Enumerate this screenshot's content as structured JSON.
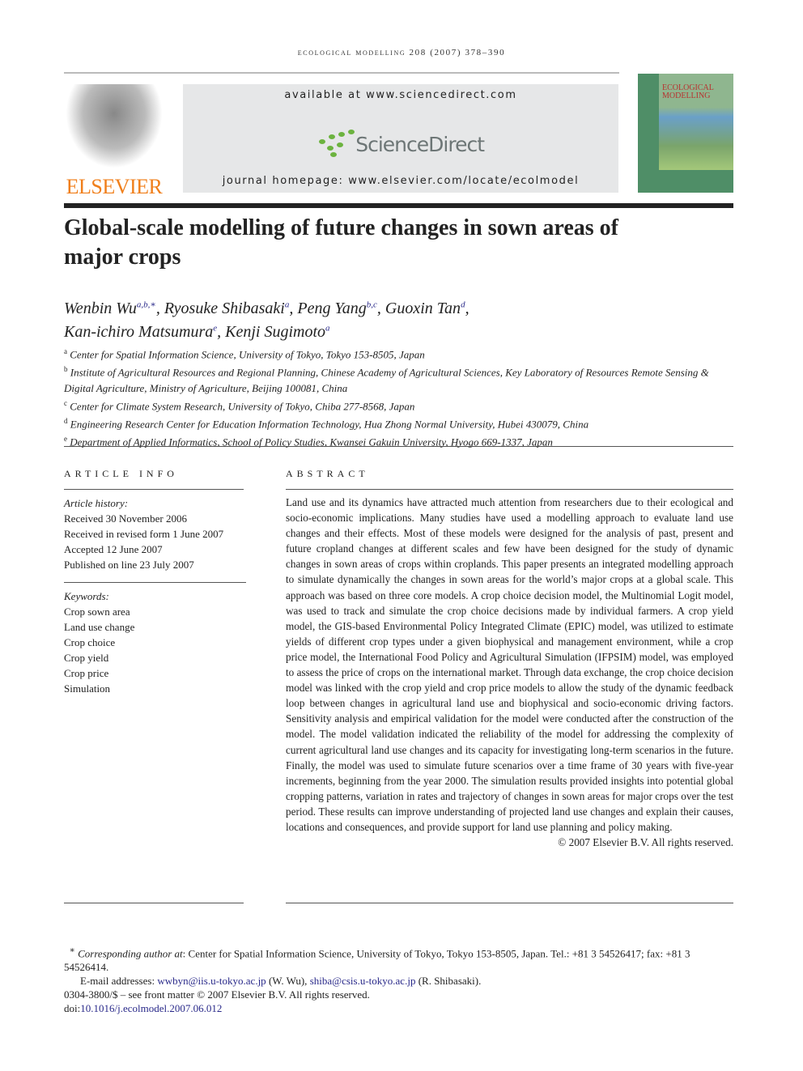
{
  "running_head": "ecological modelling 208 (2007) 378–390",
  "publisher": "ELSEVIER",
  "sciencedirect": {
    "available": "available at www.sciencedirect.com",
    "logo": "ScienceDirect",
    "homepage": "journal homepage: www.elsevier.com/locate/ecolmodel"
  },
  "cover": {
    "title": "ECOLOGICAL MODELLING"
  },
  "title": "Global-scale modelling of future changes in sown areas of major crops",
  "authors": [
    {
      "name": "Wenbin Wu",
      "sup": "a,b,∗",
      "sep": ", "
    },
    {
      "name": "Ryosuke Shibasaki",
      "sup": "a",
      "sep": ", "
    },
    {
      "name": "Peng Yang",
      "sup": "b,c",
      "sep": ", "
    },
    {
      "name": "Guoxin Tan",
      "sup": "d",
      "sep": ","
    },
    {
      "name": "Kan-ichiro Matsumura",
      "sup": "e",
      "sep": ", "
    },
    {
      "name": "Kenji Sugimoto",
      "sup": "a",
      "sep": ""
    }
  ],
  "affiliations": [
    {
      "label": "a",
      "text": "Center for Spatial Information Science, University of Tokyo, Tokyo 153-8505, Japan"
    },
    {
      "label": "b",
      "text": "Institute of Agricultural Resources and Regional Planning, Chinese Academy of Agricultural Sciences, Key Laboratory of Resources Remote Sensing & Digital Agriculture, Ministry of Agriculture, Beijing 100081, China"
    },
    {
      "label": "c",
      "text": "Center for Climate System Research, University of Tokyo, Chiba 277-8568, Japan"
    },
    {
      "label": "d",
      "text": "Engineering Research Center for Education Information Technology, Hua Zhong Normal University, Hubei 430079, China"
    },
    {
      "label": "e",
      "text": "Department of Applied Informatics, School of Policy Studies, Kwansei Gakuin University, Hyogo 669-1337, Japan"
    }
  ],
  "article_info": {
    "heading": "ARTICLE INFO",
    "history_label": "Article history:",
    "history": [
      "Received 30 November 2006",
      "Received in revised form 1 June 2007",
      "Accepted 12 June 2007",
      "Published on line 23 July 2007"
    ],
    "keywords_label": "Keywords:",
    "keywords": [
      "Crop sown area",
      "Land use change",
      "Crop choice",
      "Crop yield",
      "Crop price",
      "Simulation"
    ]
  },
  "abstract": {
    "heading": "ABSTRACT",
    "text": "Land use and its dynamics have attracted much attention from researchers due to their ecological and socio-economic implications. Many studies have used a modelling approach to evaluate land use changes and their effects. Most of these models were designed for the analysis of past, present and future cropland changes at different scales and few have been designed for the study of dynamic changes in sown areas of crops within croplands. This paper presents an integrated modelling approach to simulate dynamically the changes in sown areas for the world’s major crops at a global scale. This approach was based on three core models. A crop choice decision model, the Multinomial Logit model, was used to track and simulate the crop choice decisions made by individual farmers. A crop yield model, the GIS-based Environmental Policy Integrated Climate (EPIC) model, was utilized to estimate yields of different crop types under a given biophysical and management environment, while a crop price model, the International Food Policy and Agricultural Simulation (IFPSIM) model, was employed to assess the price of crops on the international market. Through data exchange, the crop choice decision model was linked with the crop yield and crop price models to allow the study of the dynamic feedback loop between changes in agricultural land use and biophysical and socio-economic driving factors. Sensitivity analysis and empirical validation for the model were conducted after the construction of the model. The model validation indicated the reliability of the model for addressing the complexity of current agricultural land use changes and its capacity for investigating long-term scenarios in the future. Finally, the model was used to simulate future scenarios over a time frame of 30 years with five-year increments, beginning from the year 2000. The simulation results provided insights into potential global cropping patterns, variation in rates and trajectory of changes in sown areas for major crops over the test period. These results can improve understanding of projected land use changes and explain their causes, locations and consequences, and provide support for land use planning and policy making.",
    "copyright": "© 2007 Elsevier B.V. All rights reserved."
  },
  "footnotes": {
    "star": "∗",
    "corr_label": "Corresponding author at",
    "corr_text": ": Center for Spatial Information Science, University of Tokyo, Tokyo 153-8505, Japan. Tel.: +81 3 54526417; fax: +81 3 54526414.",
    "email_label": "E-mail addresses: ",
    "email1": "wwbyn@iis.u-tokyo.ac.jp",
    "email1_who": " (W. Wu), ",
    "email2": "shiba@csis.u-tokyo.ac.jp",
    "email2_who": " (R. Shibasaki).",
    "issn": "0304-3800/$ – see front matter © 2007 Elsevier B.V. All rights reserved.",
    "doi_label": "doi:",
    "doi": "10.1016/j.ecolmodel.2007.06.012"
  }
}
